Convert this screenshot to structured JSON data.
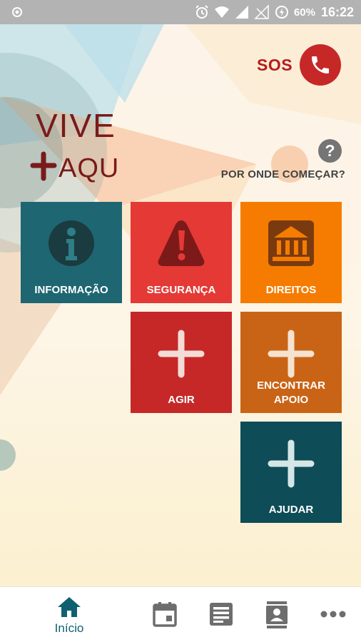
{
  "status_bar": {
    "battery_text": "60%",
    "time": "16:22"
  },
  "sos": {
    "label": "SOS"
  },
  "logo": {
    "line1": "VIVE",
    "line2": "AQUI"
  },
  "help": {
    "symbol": "?",
    "label": "POR ONDE COMEÇAR?"
  },
  "tiles": [
    {
      "label": "INFORMAÇÃO",
      "color": "#1e6672",
      "icon": "info-icon"
    },
    {
      "label": "SEGURANÇA",
      "color": "#e53935",
      "icon": "warning-icon"
    },
    {
      "label": "DIREITOS",
      "color": "#f57c00",
      "icon": "bank-icon"
    },
    {
      "label": "AGIR",
      "color": "#c62828",
      "icon": "plus-icon"
    },
    {
      "label": "ENCONTRAR APOIO",
      "color": "#c96417",
      "icon": "plus-icon"
    },
    {
      "label": "AJUDAR",
      "color": "#0e4c58",
      "icon": "plus-icon"
    }
  ],
  "bottom_nav": {
    "items": [
      {
        "label": "Início",
        "icon": "home-icon"
      },
      {
        "icon": "calendar-icon"
      },
      {
        "icon": "news-icon"
      },
      {
        "icon": "contacts-icon"
      },
      {
        "icon": "more-icon"
      }
    ],
    "accent": "#0f6171",
    "icon_color": "#6d6d6d"
  }
}
